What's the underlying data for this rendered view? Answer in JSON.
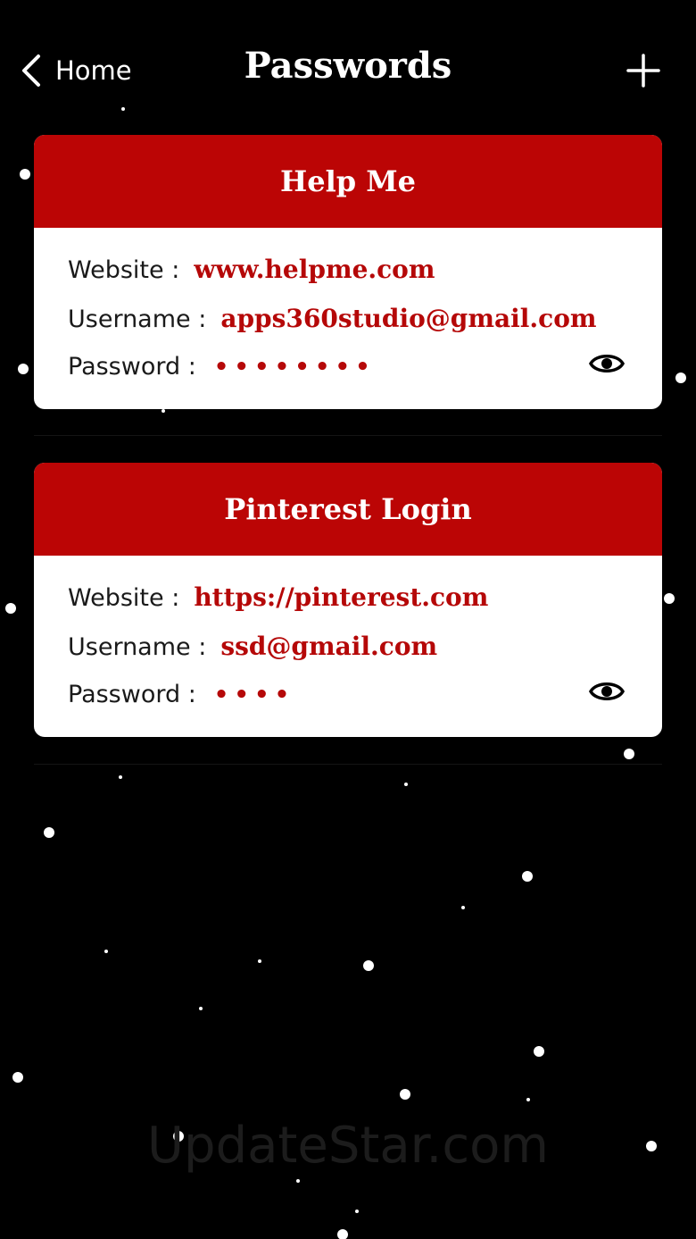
{
  "nav": {
    "back_label": "Home",
    "title": "Passwords"
  },
  "entries": [
    {
      "title": "Help Me",
      "website_label": "Website :",
      "website": "www.helpme.com",
      "username_label": "Username :",
      "username": "apps360studio@gmail.com",
      "password_label": "Password  :",
      "password_masked": "••••••••"
    },
    {
      "title": "Pinterest Login",
      "website_label": "Website :",
      "website": "https://pinterest.com",
      "username_label": "Username :",
      "username": "ssd@gmail.com",
      "password_label": "Password  :",
      "password_masked": "••••"
    }
  ],
  "watermark": "UpdateStar.com",
  "colors": {
    "background": "#000000",
    "accent_red": "#bb0505",
    "value_red": "#b50808",
    "card_bg": "#ffffff"
  },
  "icons": {
    "back": "chevron-left-icon",
    "add": "plus-icon",
    "reveal": "eye-icon"
  }
}
